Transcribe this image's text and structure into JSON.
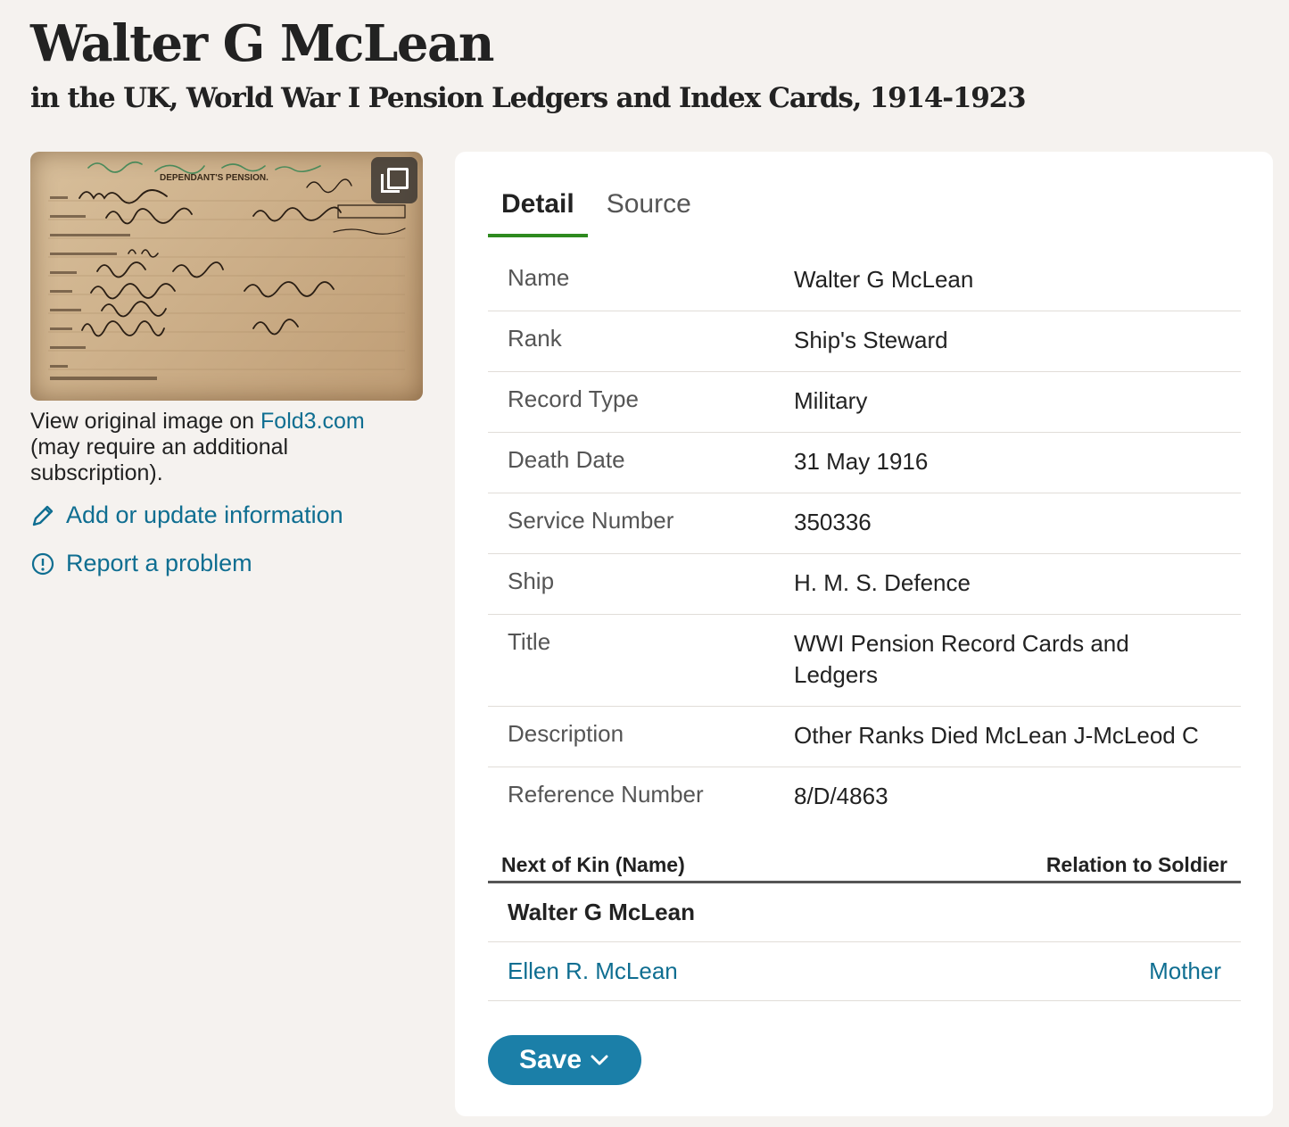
{
  "header": {
    "title": "Walter G McLean",
    "subtitle": "in the UK, World War I Pension Ledgers and Index Cards, 1914-1923"
  },
  "record_image": {
    "card_heading": "DEPENDANT'S PENSION.",
    "expand_icon": "expand-icon"
  },
  "caption": {
    "prefix": "View original image on ",
    "link": "Fold3.com",
    "suffix": "(may require an additional subscription)."
  },
  "actions": {
    "add_update": "Add or update information",
    "add_update_icon": "pencil-icon",
    "report": "Report a problem",
    "report_icon": "info-circle-icon"
  },
  "tabs": [
    {
      "label": "Detail",
      "active": true
    },
    {
      "label": "Source",
      "active": false
    }
  ],
  "details": [
    {
      "key": "Name",
      "value": "Walter G McLean"
    },
    {
      "key": "Rank",
      "value": "Ship's Steward"
    },
    {
      "key": "Record Type",
      "value": "Military"
    },
    {
      "key": "Death Date",
      "value": "31 May 1916"
    },
    {
      "key": "Service Number",
      "value": "350336"
    },
    {
      "key": "Ship",
      "value": "H. M. S. Defence"
    },
    {
      "key": "Title",
      "value": "WWI Pension Record Cards and Ledgers"
    },
    {
      "key": "Description",
      "value": "Other Ranks Died McLean J-McLeod C"
    },
    {
      "key": "Reference Number",
      "value": "8/D/4863"
    }
  ],
  "kin": {
    "col_name": "Next of Kin (Name)",
    "col_relation": "Relation to Soldier",
    "subject": "Walter G McLean",
    "rows": [
      {
        "name": "Ellen R. McLean",
        "relation": "Mother"
      }
    ]
  },
  "save": {
    "label": "Save",
    "icon": "chevron-down-icon"
  },
  "colors": {
    "link": "#0f6e91",
    "tab_underline": "#2e8a1f",
    "save_button": "#1b7fa8",
    "page_bg": "#f5f2ef"
  }
}
